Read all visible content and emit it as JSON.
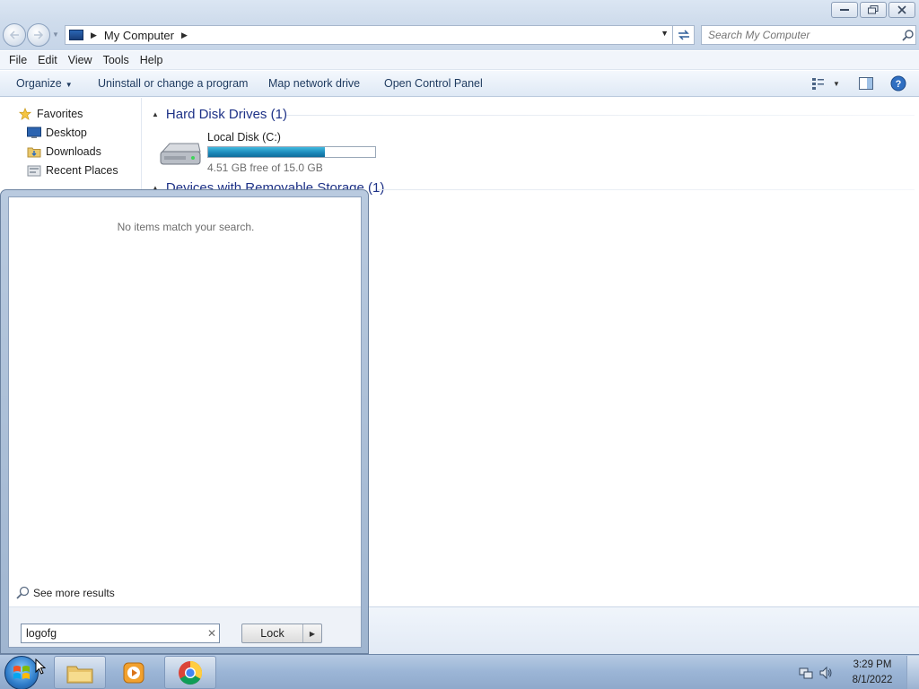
{
  "window": {
    "title": ""
  },
  "address_bar": {
    "path": "My Computer"
  },
  "search": {
    "placeholder": "Search My Computer"
  },
  "menubar": {
    "items": [
      "File",
      "Edit",
      "View",
      "Tools",
      "Help"
    ]
  },
  "command_bar": {
    "organize": "Organize",
    "uninstall": "Uninstall or change a program",
    "map_drive": "Map network drive",
    "control_panel": "Open Control Panel"
  },
  "nav_pane": {
    "favorites": "Favorites",
    "items": [
      "Desktop",
      "Downloads",
      "Recent Places"
    ]
  },
  "content": {
    "groups": [
      {
        "title": "Hard Disk Drives (1)"
      },
      {
        "title": "Devices with Removable Storage (1)"
      }
    ],
    "drive": {
      "name": "Local Disk (C:)",
      "free_text": "4.51 GB free of 15.0 GB",
      "used_fraction": 0.7
    }
  },
  "start_menu": {
    "no_results": "No items match your search.",
    "see_more": "See more results",
    "search_value": "logofg",
    "lock_label": "Lock"
  },
  "taskbar": {
    "time": "3:29 PM",
    "date": "8/1/2022",
    "apps": [
      "windows-explorer",
      "media-player",
      "chrome"
    ]
  },
  "colors": {
    "drive_bar": "#26a0da",
    "group_header": "#1e3287",
    "taskbar": "#9bb5d6"
  }
}
